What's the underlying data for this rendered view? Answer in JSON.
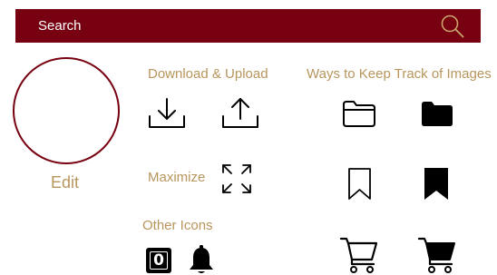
{
  "search": {
    "label": "Search",
    "icon": "search-icon",
    "bar_color": "#770011"
  },
  "profile": {
    "edit_label": "Edit",
    "ring_color": "#770011"
  },
  "sections": {
    "download_upload": {
      "title": "Download & Upload",
      "icons": [
        "download-icon",
        "upload-icon"
      ]
    },
    "maximize": {
      "title": "Maximize",
      "icons": [
        "maximize-icon"
      ]
    },
    "other_icons": {
      "title": "Other Icons",
      "badge_count": "0",
      "icons": [
        "notification-badge",
        "bell-icon"
      ]
    },
    "ways_to_keep_track": {
      "title": "Ways to Keep Track of Images",
      "icons": [
        "folder-outline-icon",
        "folder-filled-icon",
        "bookmark-outline-icon",
        "bookmark-filled-icon",
        "cart-outline-icon",
        "cart-filled-icon"
      ]
    }
  },
  "colors": {
    "accent": "#770011",
    "label_gold": "#b8955d",
    "icon": "#000000"
  }
}
